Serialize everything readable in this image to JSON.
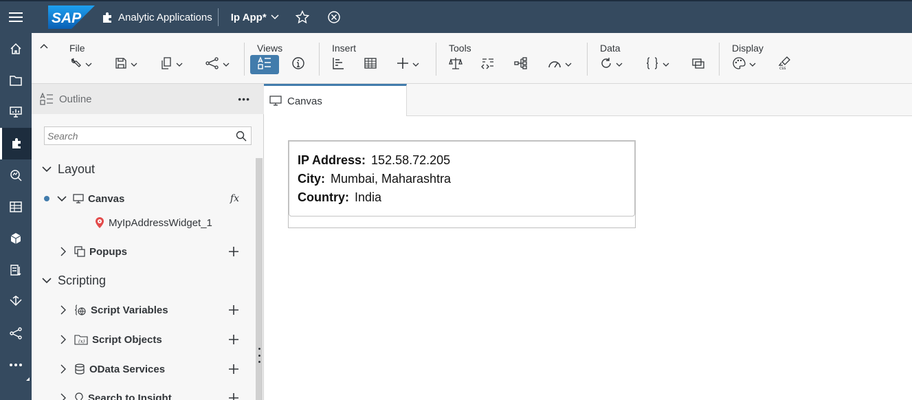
{
  "shell": {
    "logo_text": "SAP",
    "app_name": "Analytic Applications",
    "file_title": "Ip App*"
  },
  "toolbar": {
    "groups": {
      "file": "File",
      "views": "Views",
      "insert": "Insert",
      "tools": "Tools",
      "data": "Data",
      "display": "Display"
    }
  },
  "outline": {
    "title": "Outline",
    "more": "•••",
    "search_placeholder": "Search",
    "layout_label": "Layout",
    "canvas_label": "Canvas",
    "fx_label": "fx",
    "widget_label": "MyIpAddressWidget_1",
    "popups_label": "Popups",
    "scripting_label": "Scripting",
    "script_variables_label": "Script Variables",
    "script_objects_label": "Script Objects",
    "odata_label": "OData Services",
    "search_insight_label": "Search to Insight"
  },
  "canvas": {
    "tab_label": "Canvas",
    "widget": {
      "ip_key": "IP Address:",
      "ip_value": "152.58.72.205",
      "city_key": "City:",
      "city_value": "Mumbai, Maharashtra",
      "country_key": "Country:",
      "country_value": "India"
    }
  },
  "colors": {
    "shell": "#354a5f",
    "shell_dark": "#1d2d3e",
    "accent": "#427cac",
    "toolbar_bg": "#f7f7f7",
    "sap_blue": "#1a73c9"
  }
}
